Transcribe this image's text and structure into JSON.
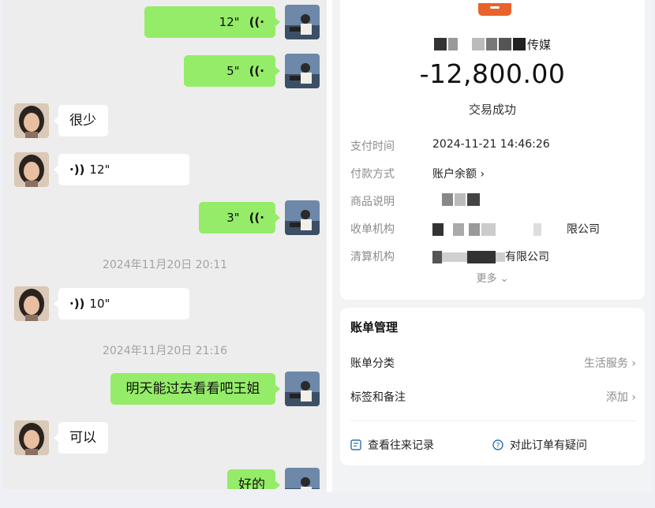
{
  "chat": {
    "messages": [
      {
        "side": "me",
        "type": "voice",
        "duration": "12\"",
        "wave": "((·"
      },
      {
        "side": "me",
        "type": "voice",
        "duration": "5\"",
        "wave": "((·"
      },
      {
        "side": "them",
        "type": "text",
        "text": "很少"
      },
      {
        "side": "them",
        "type": "voice",
        "duration": "12\"",
        "wave": "·))"
      },
      {
        "side": "me",
        "type": "voice",
        "duration": "3\"",
        "wave": "((·"
      },
      {
        "type": "timestamp",
        "text": "2024年11月20日 20:11"
      },
      {
        "side": "them",
        "type": "voice",
        "duration": "10\"",
        "wave": "·))"
      },
      {
        "type": "timestamp",
        "text": "2024年11月20日 21:16"
      },
      {
        "side": "me",
        "type": "text",
        "text": "明天能过去看看吧王姐"
      },
      {
        "side": "them",
        "type": "text",
        "text": "可以"
      },
      {
        "side": "me",
        "type": "text",
        "text": "好的"
      }
    ]
  },
  "bill": {
    "merchant_suffix": "传媒",
    "amount": "-12,800.00",
    "status": "交易成功",
    "details": [
      {
        "key": "支付时间",
        "value": "2024-11-21 14:46:26"
      },
      {
        "key": "付款方式",
        "value": "账户余额 ›"
      },
      {
        "key": "商品说明",
        "value": ""
      },
      {
        "key": "收单机构",
        "value": "限公司"
      },
      {
        "key": "清算机构",
        "value": "有限公司"
      }
    ],
    "more": "更多 ⌄",
    "management": {
      "title": "账单管理",
      "category_label": "账单分类",
      "category_value": "生活服务 ›",
      "tag_label": "标签和备注",
      "tag_value": "添加 ›",
      "history_label": "查看往来记录",
      "question_label": "对此订单有疑问"
    }
  },
  "colors": {
    "my_bubble": "#95ec69",
    "their_bubble": "#ffffff",
    "chat_bg": "#ededed",
    "brand": "#e8622c"
  },
  "icons": [
    "avatar-self",
    "avatar-other",
    "voice-wave-icon",
    "mosaic-redaction",
    "record-icon",
    "question-icon",
    "chevron-right-icon",
    "chevron-down-icon"
  ]
}
